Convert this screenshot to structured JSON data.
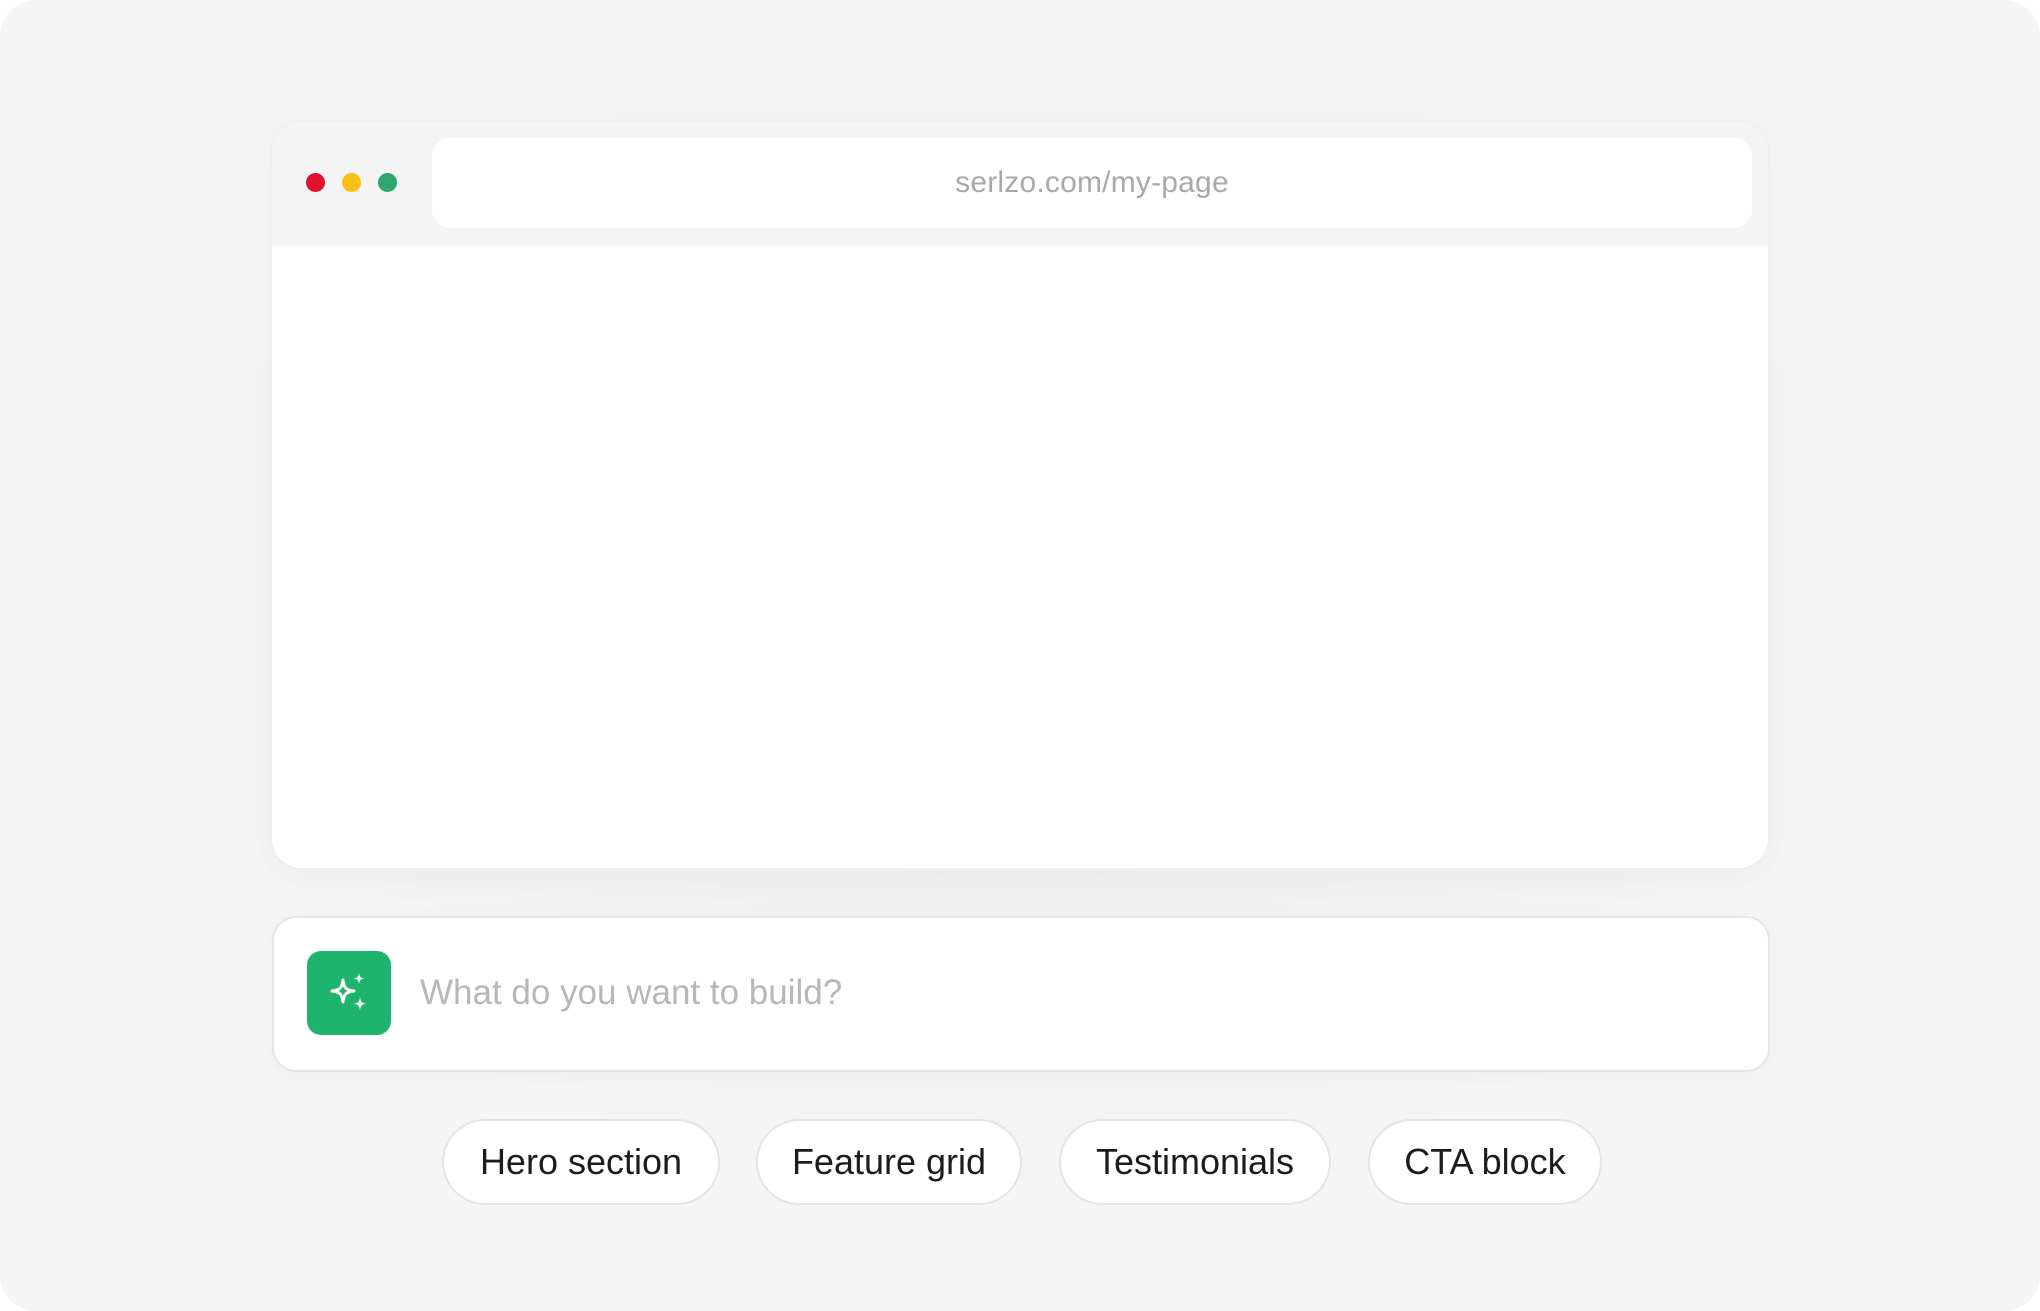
{
  "browser": {
    "url": "serlzo.com/my-page",
    "traffic_lights": {
      "close_color": "#e0102f",
      "minimize_color": "#f9bf14",
      "maximize_color": "#2ea66c"
    }
  },
  "prompt": {
    "icon": "sparkles-icon",
    "icon_color": "#1fb46e",
    "placeholder": "What do you want to build?",
    "value": ""
  },
  "suggestions": [
    {
      "label": "Hero section"
    },
    {
      "label": "Feature grid"
    },
    {
      "label": "Testimonials"
    },
    {
      "label": "CTA block"
    }
  ]
}
